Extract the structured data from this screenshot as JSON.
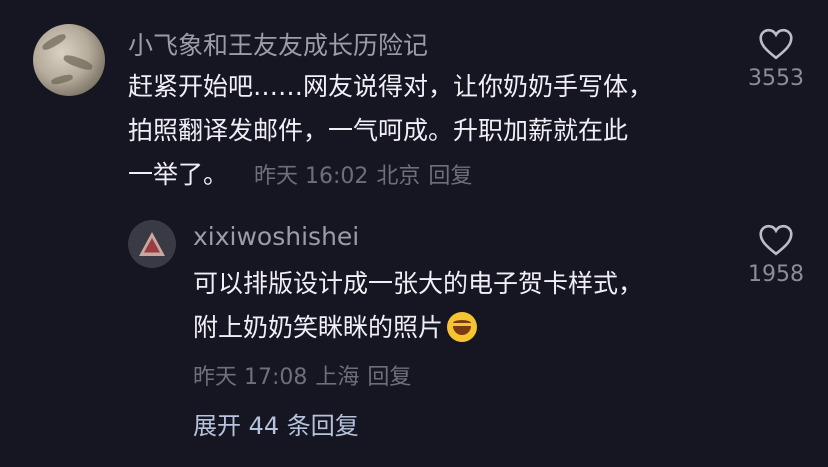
{
  "comment": {
    "username": "小飞象和王友友成长历险记",
    "lines": [
      "赶紧开始吧……网友说得对，让你奶奶手写体，",
      "拍照翻译发邮件，一气呵成。升职加薪就在此",
      "一举了。"
    ],
    "time": "昨天 16:02",
    "location": "北京",
    "reply_label": "回复",
    "likes": "3553"
  },
  "reply": {
    "username": "xixiwoshishei",
    "lines": [
      "可以排版设计成一张大的电子贺卡样式，",
      "附上奶奶笑眯眯的照片"
    ],
    "emoji": "laughing-tears-emoji",
    "time": "昨天 17:08",
    "location": "上海",
    "reply_label": "回复",
    "likes": "1958"
  },
  "expand_label": "展开 44 条回复"
}
